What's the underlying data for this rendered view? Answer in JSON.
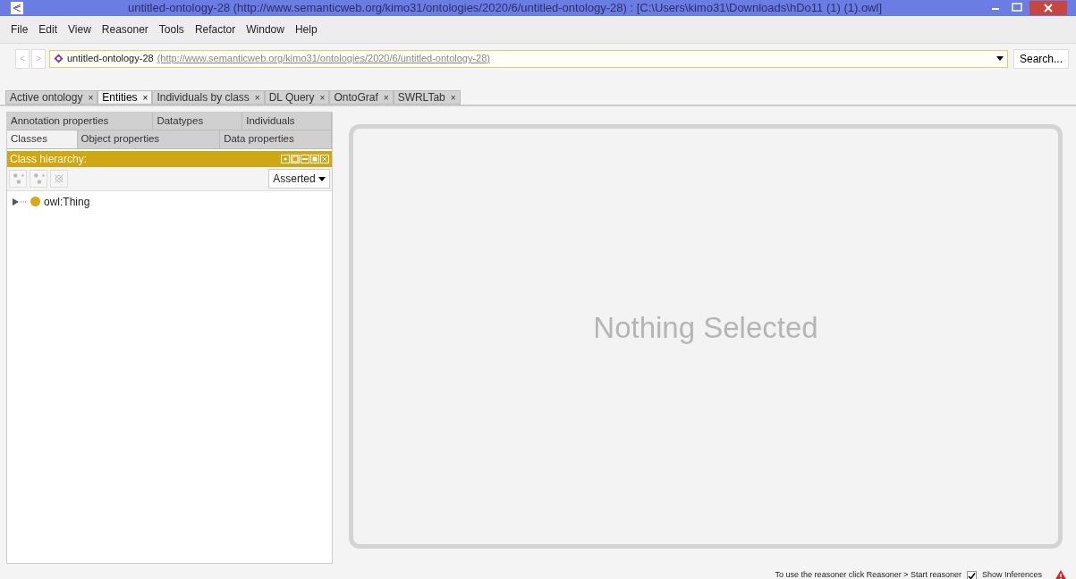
{
  "window": {
    "title": "untitled-ontology-28 (http://www.semanticweb.org/kimo31/ontologies/2020/6/untitled-ontology-28)  : [C:\\Users\\kimo31\\Downloads\\hDo11 (1) (1).owl]"
  },
  "menu": [
    "File",
    "Edit",
    "View",
    "Reasoner",
    "Tools",
    "Refactor",
    "Window",
    "Help"
  ],
  "address": {
    "back": "<",
    "forward": ">",
    "name": "untitled-ontology-28",
    "iri": "(http://www.semanticweb.org/kimo31/ontologies/2020/6/untitled-ontology-28)",
    "search": "Search..."
  },
  "tabs": [
    {
      "label": "Active ontology",
      "close": "×",
      "selected": false
    },
    {
      "label": "Entities",
      "close": "×",
      "selected": true
    },
    {
      "label": "Individuals by class",
      "close": "×",
      "selected": false
    },
    {
      "label": "DL Query",
      "close": "×",
      "selected": false
    },
    {
      "label": "OntoGraf",
      "close": "×",
      "selected": false
    },
    {
      "label": "SWRLTab",
      "close": "×",
      "selected": false
    }
  ],
  "entity_tabs": [
    [
      {
        "label": "Annotation properties",
        "selected": false
      },
      {
        "label": "Datatypes",
        "selected": false
      },
      {
        "label": "Individuals",
        "selected": false
      }
    ],
    [
      {
        "label": "Classes",
        "selected": true
      },
      {
        "label": "Object properties",
        "selected": false
      },
      {
        "label": "Data properties",
        "selected": false
      }
    ]
  ],
  "class_hierarchy": {
    "title": "Class hierarchy:",
    "mode": "Asserted",
    "tree": [
      {
        "label": "owl:Thing",
        "expanded": false
      }
    ]
  },
  "main": {
    "message": "Nothing Selected"
  },
  "status_bar": {
    "hint": "To use the reasoner click Reasoner > Start reasoner",
    "show_inferences": {
      "label": "Show Inferences",
      "checked": true
    }
  }
}
